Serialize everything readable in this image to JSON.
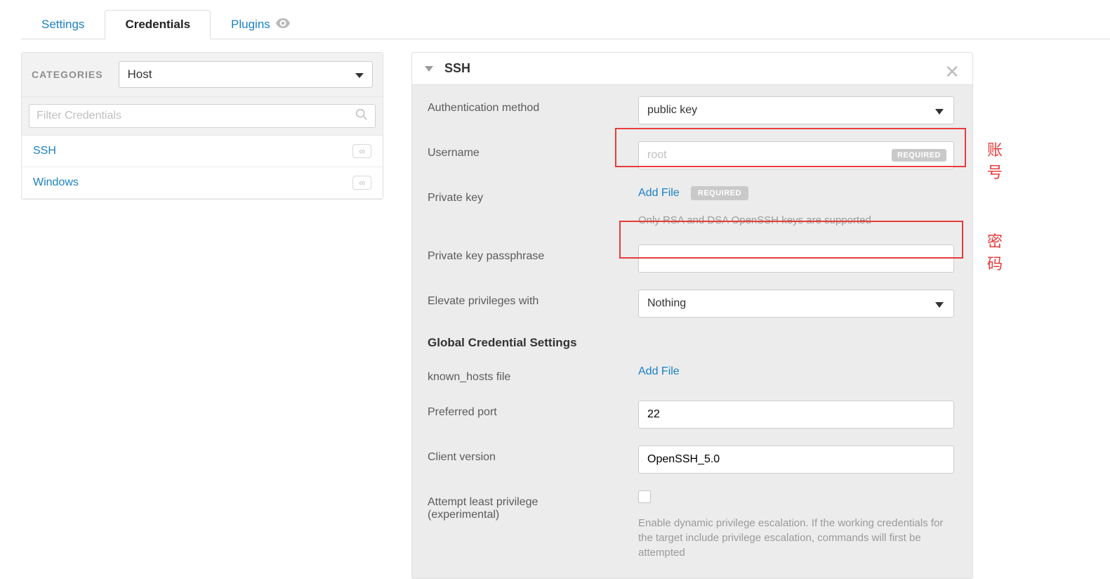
{
  "tabs": {
    "settings": "Settings",
    "credentials": "Credentials",
    "plugins": "Plugins"
  },
  "sidebar": {
    "categories_label": "CATEGORIES",
    "host_selected": "Host",
    "filter_placeholder": "Filter Credentials",
    "items": [
      {
        "label": "SSH"
      },
      {
        "label": "Windows"
      }
    ]
  },
  "panel": {
    "title": "SSH",
    "auth_method_label": "Authentication method",
    "auth_method_value": "public key",
    "username_label": "Username",
    "username_placeholder": "root",
    "required_badge": "REQUIRED",
    "private_key_label": "Private key",
    "add_file": "Add File",
    "private_key_hint": "Only RSA and DSA OpenSSH keys are supported",
    "passphrase_label": "Private key passphrase",
    "elevate_label": "Elevate privileges with",
    "elevate_value": "Nothing",
    "global_section": "Global Credential Settings",
    "known_hosts_label": "known_hosts file",
    "preferred_port_label": "Preferred port",
    "preferred_port_value": "22",
    "client_version_label": "Client version",
    "client_version_value": "OpenSSH_5.0",
    "least_priv_label_1": "Attempt least privilege",
    "least_priv_label_2": "(experimental)",
    "least_priv_hint": "Enable dynamic privilege escalation. If the working credentials for the target include privilege escalation, commands will first be attempted"
  },
  "annotations": {
    "account": "账号",
    "password": "密码"
  }
}
